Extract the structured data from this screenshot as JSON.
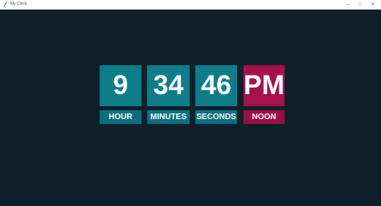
{
  "window": {
    "title": "My Clock"
  },
  "clock": {
    "hour": "9",
    "minutes": "34",
    "seconds": "46",
    "ampm": "PM",
    "labels": {
      "hour": "HOUR",
      "minutes": "MINUTES",
      "seconds": "SECONDS",
      "noon": "NOON"
    }
  },
  "colors": {
    "background": "#0e1f2a",
    "teal": "#0d7d8a",
    "teal_label": "#0c6f7f",
    "magenta": "#a3124c",
    "magenta_label": "#9b0f48",
    "text": "#ffffff"
  },
  "icons": {
    "app": "feather-icon",
    "minimize": "minimize-icon",
    "maximize": "maximize-icon",
    "close": "close-icon"
  }
}
